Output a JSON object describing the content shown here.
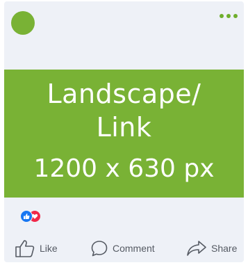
{
  "banner": {
    "line1": "Landscape/",
    "line2": "Link",
    "line3": "1200 x 630 px"
  },
  "actions": {
    "like": "Like",
    "comment": "Comment",
    "share": "Share"
  },
  "colors": {
    "brand_green": "#79b235",
    "card_bg": "#eef1f7",
    "like_blue": "#1877f2",
    "love_red": "#f02849"
  },
  "icons": [
    "avatar",
    "more-icon",
    "like-reaction-icon",
    "love-reaction-icon",
    "thumbs-up-icon",
    "comment-icon",
    "share-icon"
  ]
}
